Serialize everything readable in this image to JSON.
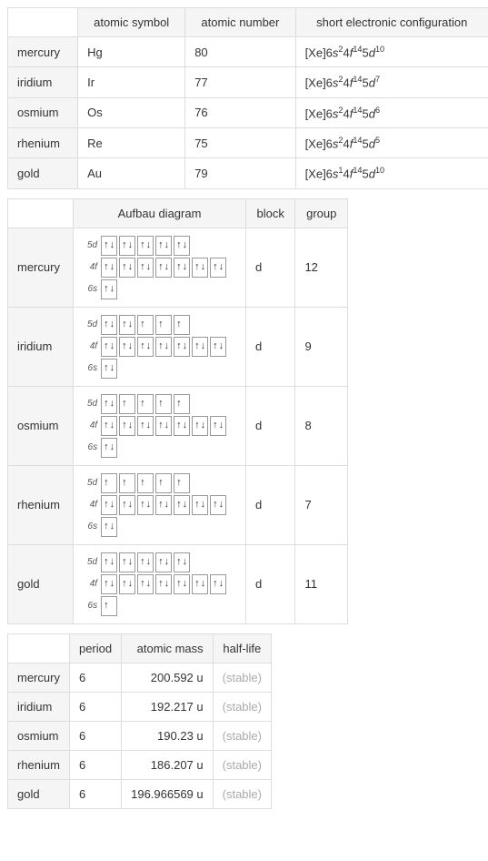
{
  "table1": {
    "headers": [
      "",
      "atomic symbol",
      "atomic number",
      "short electronic configuration"
    ],
    "rows": [
      {
        "name": "mercury",
        "symbol": "Hg",
        "number": "80",
        "config": {
          "prefix": "[Xe]6",
          "s": "2",
          "fshell": "4",
          "f": "14",
          "dshell": "5",
          "d": "10"
        }
      },
      {
        "name": "iridium",
        "symbol": "Ir",
        "number": "77",
        "config": {
          "prefix": "[Xe]6",
          "s": "2",
          "fshell": "4",
          "f": "14",
          "dshell": "5",
          "d": "7"
        }
      },
      {
        "name": "osmium",
        "symbol": "Os",
        "number": "76",
        "config": {
          "prefix": "[Xe]6",
          "s": "2",
          "fshell": "4",
          "f": "14",
          "dshell": "5",
          "d": "6"
        }
      },
      {
        "name": "rhenium",
        "symbol": "Re",
        "number": "75",
        "config": {
          "prefix": "[Xe]6",
          "s": "2",
          "fshell": "4",
          "f": "14",
          "dshell": "5",
          "d": "5"
        }
      },
      {
        "name": "gold",
        "symbol": "Au",
        "number": "79",
        "config": {
          "prefix": "[Xe]6",
          "s": "1",
          "fshell": "4",
          "f": "14",
          "dshell": "5",
          "d": "10"
        }
      }
    ]
  },
  "table2": {
    "headers": [
      "",
      "Aufbau diagram",
      "block",
      "group"
    ],
    "rows": [
      {
        "name": "mercury",
        "d5": [
          2,
          2,
          2,
          2,
          2
        ],
        "f4": [
          2,
          2,
          2,
          2,
          2,
          2,
          2
        ],
        "s6": [
          2
        ],
        "block": "d",
        "group": "12"
      },
      {
        "name": "iridium",
        "d5": [
          2,
          2,
          1,
          1,
          1
        ],
        "f4": [
          2,
          2,
          2,
          2,
          2,
          2,
          2
        ],
        "s6": [
          2
        ],
        "block": "d",
        "group": "9"
      },
      {
        "name": "osmium",
        "d5": [
          2,
          1,
          1,
          1,
          1
        ],
        "f4": [
          2,
          2,
          2,
          2,
          2,
          2,
          2
        ],
        "s6": [
          2
        ],
        "block": "d",
        "group": "8"
      },
      {
        "name": "rhenium",
        "d5": [
          1,
          1,
          1,
          1,
          1
        ],
        "f4": [
          2,
          2,
          2,
          2,
          2,
          2,
          2
        ],
        "s6": [
          2
        ],
        "block": "d",
        "group": "7"
      },
      {
        "name": "gold",
        "d5": [
          2,
          2,
          2,
          2,
          2
        ],
        "f4": [
          2,
          2,
          2,
          2,
          2,
          2,
          2
        ],
        "s6": [
          1
        ],
        "block": "d",
        "group": "11"
      }
    ],
    "labels": {
      "d5": "5d",
      "f4": "4f",
      "s6": "6s"
    }
  },
  "table3": {
    "headers": [
      "",
      "period",
      "atomic mass",
      "half-life"
    ],
    "rows": [
      {
        "name": "mercury",
        "period": "6",
        "mass": "200.592 u",
        "halflife": "(stable)"
      },
      {
        "name": "iridium",
        "period": "6",
        "mass": "192.217 u",
        "halflife": "(stable)"
      },
      {
        "name": "osmium",
        "period": "6",
        "mass": "190.23 u",
        "halflife": "(stable)"
      },
      {
        "name": "rhenium",
        "period": "6",
        "mass": "186.207 u",
        "halflife": "(stable)"
      },
      {
        "name": "gold",
        "period": "6",
        "mass": "196.966569 u",
        "halflife": "(stable)"
      }
    ]
  }
}
